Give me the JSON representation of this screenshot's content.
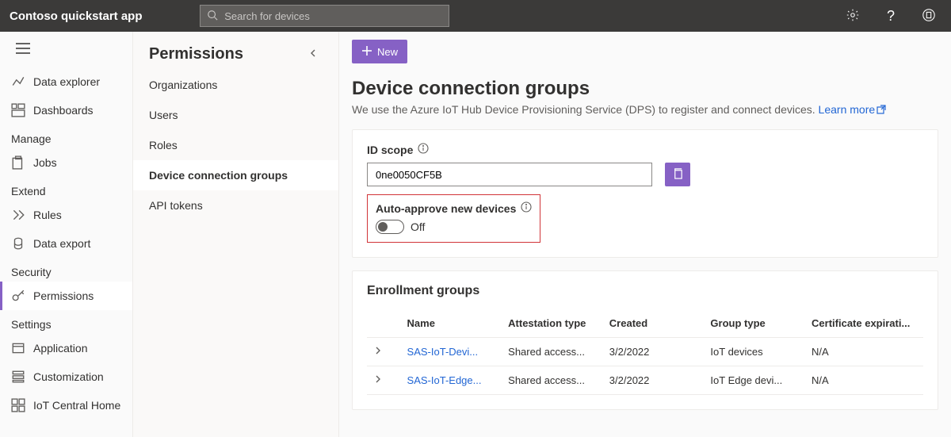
{
  "app_title": "Contoso quickstart app",
  "search_placeholder": "Search for devices",
  "primary_nav": {
    "items": [
      {
        "label": "Data explorer"
      },
      {
        "label": "Dashboards"
      }
    ],
    "sections": [
      {
        "label": "Manage",
        "items": [
          {
            "label": "Jobs"
          }
        ]
      },
      {
        "label": "Extend",
        "items": [
          {
            "label": "Rules"
          },
          {
            "label": "Data export"
          }
        ]
      },
      {
        "label": "Security",
        "items": [
          {
            "label": "Permissions"
          }
        ]
      },
      {
        "label": "Settings",
        "items": [
          {
            "label": "Application"
          },
          {
            "label": "Customization"
          },
          {
            "label": "IoT Central Home"
          }
        ]
      }
    ]
  },
  "secondary_nav": {
    "title": "Permissions",
    "items": [
      {
        "label": "Organizations"
      },
      {
        "label": "Users"
      },
      {
        "label": "Roles"
      },
      {
        "label": "Device connection groups"
      },
      {
        "label": "API tokens"
      }
    ]
  },
  "toolbar": {
    "new_label": "New"
  },
  "page": {
    "title": "Device connection groups",
    "desc_prefix": "We use the Azure IoT Hub Device Provisioning Service (DPS) to register and connect devices. ",
    "learn_more": "Learn more"
  },
  "id_scope": {
    "label": "ID scope",
    "value": "0ne0050CF5B"
  },
  "auto_approve": {
    "label": "Auto-approve new devices",
    "status": "Off"
  },
  "enrollment": {
    "title": "Enrollment groups",
    "columns": {
      "name": "Name",
      "att": "Attestation type",
      "created": "Created",
      "gtype": "Group type",
      "cert": "Certificate expirati..."
    },
    "rows": [
      {
        "name": "SAS-IoT-Devi...",
        "att": "Shared access...",
        "created": "3/2/2022",
        "gtype": "IoT devices",
        "cert": "N/A"
      },
      {
        "name": "SAS-IoT-Edge...",
        "att": "Shared access...",
        "created": "3/2/2022",
        "gtype": "IoT Edge devi...",
        "cert": "N/A"
      }
    ]
  }
}
